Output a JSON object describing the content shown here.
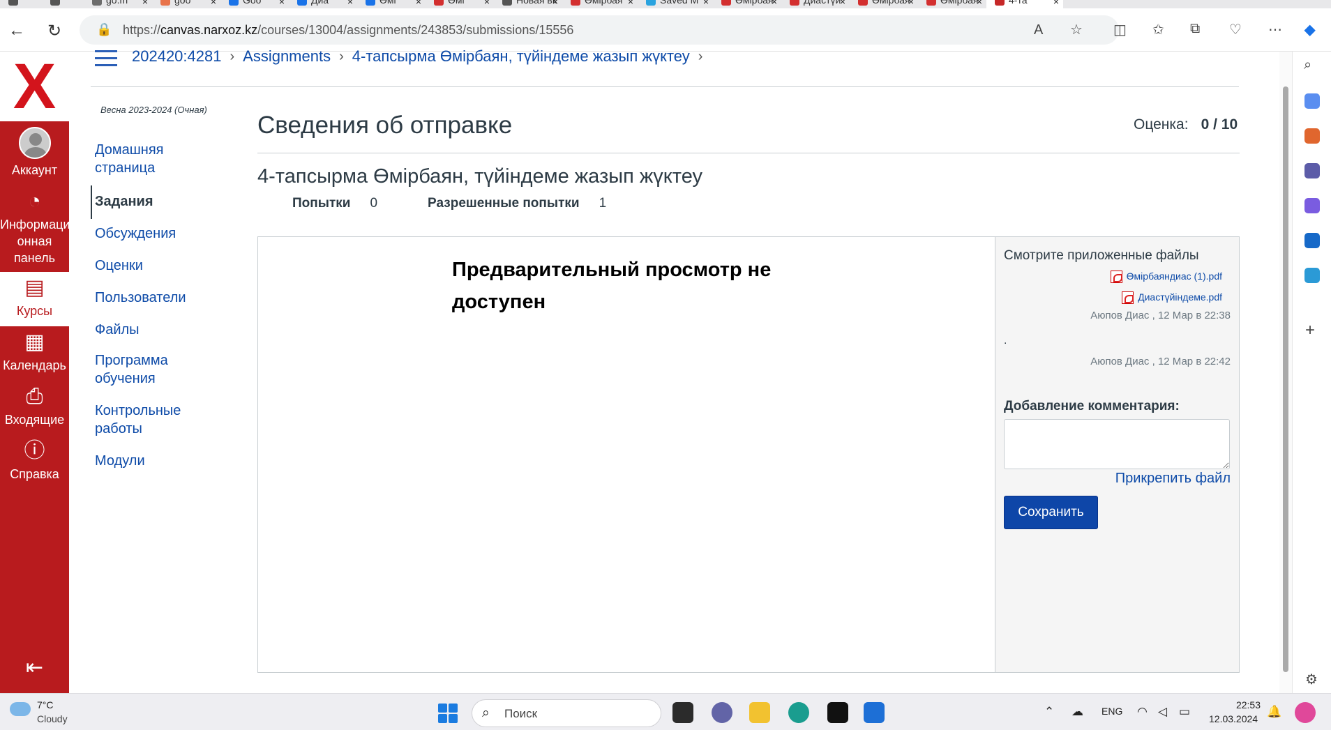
{
  "browser": {
    "tabs": [
      {
        "label": "",
        "color": "#555555"
      },
      {
        "label": "",
        "color": "#555555"
      },
      {
        "label": "go.m",
        "color": "#6d6d6d"
      },
      {
        "label": "goo",
        "color": "#e8734a"
      },
      {
        "label": "Goo",
        "color": "#1a73e8"
      },
      {
        "label": "Диа",
        "color": "#1a73e8"
      },
      {
        "label": "Өмі",
        "color": "#1a73e8"
      },
      {
        "label": "Өмі",
        "color": "#d32f2f"
      },
      {
        "label": "Новая вк",
        "color": "#555555"
      },
      {
        "label": "Өмірбая",
        "color": "#d32f2f"
      },
      {
        "label": "Saved M",
        "color": "#2aa3df"
      },
      {
        "label": "Өмірбая",
        "color": "#d32f2f"
      },
      {
        "label": "Диастүй",
        "color": "#d32f2f"
      },
      {
        "label": "Өмірбая",
        "color": "#d32f2f"
      },
      {
        "label": "Өмірбая",
        "color": "#d32f2f"
      },
      {
        "label": "4-та",
        "color": "#c62828",
        "active": true
      }
    ],
    "url_prefix": "https://",
    "url_host": "canvas.narxoz.kz",
    "url_path": "/courses/13004/assignments/243853/submissions/15556"
  },
  "global_nav": {
    "logo_letter": "X",
    "items": [
      {
        "label": "Аккаунт",
        "icon": "account-avatar-icon"
      },
      {
        "label": "Информационная панель",
        "label_lines": [
          "Информаци",
          "онная",
          "панель"
        ],
        "icon": "dashboard-icon"
      },
      {
        "label": "Курсы",
        "icon": "courses-icon"
      },
      {
        "label": "Календарь",
        "icon": "calendar-icon"
      },
      {
        "label": "Входящие",
        "icon": "inbox-icon"
      },
      {
        "label": "Справка",
        "icon": "help-icon"
      }
    ],
    "collapse_icon": "collapse-nav-icon",
    "brand_color": "#b81b1e"
  },
  "breadcrumb": {
    "items": [
      "202420:4281",
      "Assignments",
      "4-тапсырма Өмірбаян, түйіндеме жазып жүктеу"
    ]
  },
  "course_nav": {
    "term": "Весна 2023-2024 (Очная)",
    "items": [
      {
        "label": "Домашняя страница"
      },
      {
        "label": "Задания",
        "active": true
      },
      {
        "label": "Обсуждения"
      },
      {
        "label": "Оценки"
      },
      {
        "label": "Пользователи"
      },
      {
        "label": "Файлы"
      },
      {
        "label": "Программа обучения"
      },
      {
        "label": "Контрольные работы"
      },
      {
        "label": "Модули"
      }
    ]
  },
  "submission": {
    "page_title": "Сведения об отправке",
    "grade_label": "Оценка:",
    "grade_value": "0 / 10",
    "assignment_title": "4-тапсырма Өмірбаян, түйіндеме жазып жүктеу",
    "attempts_label": "Попытки",
    "attempts_value": "0",
    "allowed_label": "Разрешенные попытки",
    "allowed_value": "1",
    "preview_message": "Предварительный просмотр не доступен"
  },
  "comments": {
    "attachments_title": "Смотрите приложенные файлы",
    "files": [
      "Өмірбаяндиас (1).pdf",
      "Диастүйіндеме.pdf"
    ],
    "entries": [
      {
        "author": "Аюпов Диас",
        "date": "12 Мар в 22:38"
      },
      {
        "text": ".",
        "author": "Аюпов Диас",
        "date": "12 Мар в 22:42"
      }
    ],
    "add_comment_label": "Добавление комментария:",
    "attach_file_label": "Прикрепить файл",
    "save_label": "Сохранить"
  },
  "taskbar": {
    "temperature": "7°C",
    "weather": "Cloudy",
    "search_placeholder": "Поиск",
    "language": "ENG",
    "time": "22:53",
    "date": "12.03.2024"
  }
}
